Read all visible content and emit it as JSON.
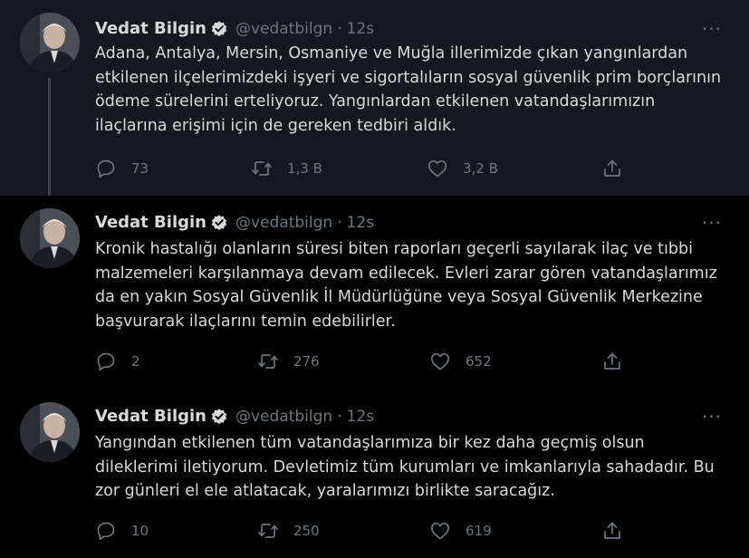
{
  "tweets": [
    {
      "name": "Vedat Bilgin",
      "handle": "@vedatbilgn",
      "sep": "·",
      "time": "12s",
      "more": "···",
      "text": "Adana, Antalya, Mersin, Osmaniye ve Muğla illerimizde çıkan yangınlardan etkilenen ilçelerimizdeki işyeri ve sigortalıların sosyal güvenlik prim borçlarının ödeme sürelerini erteliyoruz. Yangınlardan etkilenen vatandaşlarımızın ilaçlarına erişimi için de gereken tedbiri aldık.",
      "replies": "73",
      "retweets": "1,3 B",
      "likes": "3,2 B"
    },
    {
      "name": "Vedat Bilgin",
      "handle": "@vedatbilgn",
      "sep": "·",
      "time": "12s",
      "more": "···",
      "text": "Kronik hastalığı olanların süresi biten raporları geçerli sayılarak ilaç ve tıbbi malzemeleri karşılanmaya devam edilecek. Evleri zarar gören vatandaşlarımız da en yakın Sosyal Güvenlik İl Müdürlüğüne veya Sosyal Güvenlik Merkezine başvurarak ilaçlarını temin edebilirler.",
      "replies": "2",
      "retweets": "276",
      "likes": "652"
    },
    {
      "name": "Vedat Bilgin",
      "handle": "@vedatbilgn",
      "sep": "·",
      "time": "12s",
      "more": "···",
      "text": "Yangından etkilenen tüm vatandaşlarımıza bir kez daha geçmiş olsun dileklerimi iletiyorum. Devletimiz tüm kurumları ve imkanlarıyla sahadadır. Bu zor günleri el ele atlatacak, yaralarımızı birlikte saracağız.",
      "replies": "10",
      "retweets": "250",
      "likes": "619"
    }
  ],
  "icons": {
    "verified": "verified-badge-icon",
    "reply": "reply-icon",
    "retweet": "retweet-icon",
    "like": "heart-icon",
    "share": "share-icon",
    "more": "more-icon"
  },
  "colors": {
    "background": "#000000",
    "highlighted_tweet": "#15181c",
    "text": "#d9d9d9",
    "muted": "#6e767d",
    "verified": "#d9d9d9"
  }
}
